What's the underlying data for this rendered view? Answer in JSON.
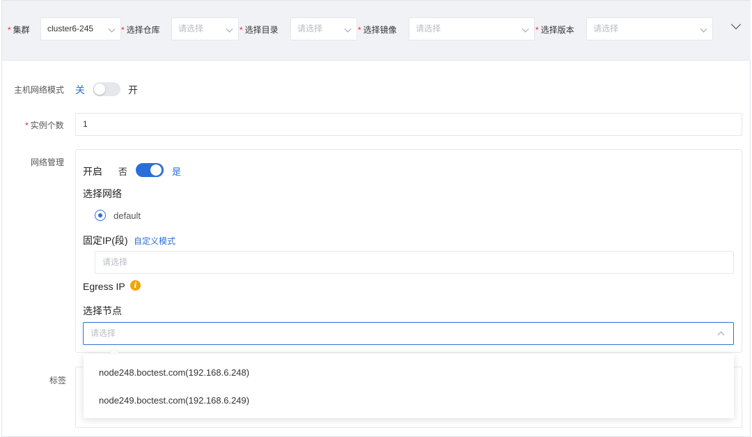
{
  "filter_bar": {
    "cluster": {
      "label": "集群",
      "value": "cluster6-245"
    },
    "repository": {
      "label": "选择仓库",
      "placeholder": "请选择"
    },
    "directory": {
      "label": "选择目录",
      "placeholder": "请选择"
    },
    "image": {
      "label": "选择镜像",
      "placeholder": "请选择"
    },
    "version": {
      "label": "选择版本",
      "placeholder": "请选择"
    },
    "required_mark": "*"
  },
  "form": {
    "host_network": {
      "label": "主机网络模式",
      "off_text": "关",
      "on_text": "开",
      "enabled": false
    },
    "instance_count": {
      "label": "实例个数",
      "value": "1"
    },
    "network_mgmt": {
      "label": "网络管理",
      "enable_label": "开启",
      "off_text": "否",
      "on_text": "是",
      "enabled": true,
      "select_network_title": "选择网络",
      "network_option": "default",
      "fixed_ip_title": "固定IP(段)",
      "custom_mode_link": "自定义模式",
      "fixed_ip_placeholder": "请选择",
      "egress_title": "Egress IP",
      "select_node_title": "选择节点",
      "node_placeholder": "请选择"
    },
    "tags": {
      "label": "标签"
    }
  },
  "node_dropdown": {
    "options": [
      "node248.boctest.com(192.168.6.248)",
      "node249.boctest.com(192.168.6.249)"
    ]
  },
  "icons": {
    "info": "info-icon",
    "chevron": "chevron-down-icon"
  },
  "colors": {
    "accent": "#2b6ed9",
    "required": "#f5222d",
    "warning": "#f0a30a",
    "filter_bg": "#f0f2f5"
  }
}
